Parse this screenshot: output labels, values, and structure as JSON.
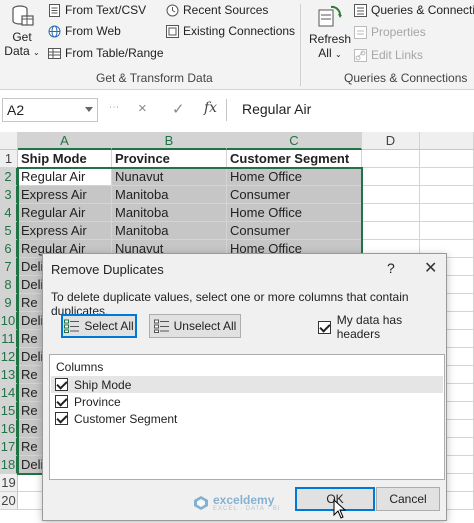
{
  "ribbon": {
    "get_data": {
      "line1": "Get",
      "line2": "Data"
    },
    "from_text_csv": "From Text/CSV",
    "from_web": "From Web",
    "from_table_range": "From Table/Range",
    "recent_sources": "Recent Sources",
    "existing_connections": "Existing Connections",
    "group_get_transform": "Get & Transform Data",
    "refresh": {
      "line1": "Refresh",
      "line2": "All"
    },
    "queries_connections": "Queries & Connections",
    "properties": "Properties",
    "edit_links": "Edit Links",
    "group_queries": "Queries & Connections"
  },
  "formula_bar": {
    "name_box": "A2",
    "cancel_icon": "×",
    "enter_icon": "✓",
    "fx_label": "fx",
    "content": "Regular Air"
  },
  "grid": {
    "columns": [
      "A",
      "B",
      "C",
      "D"
    ],
    "row_numbers": [
      "1",
      "2",
      "3",
      "4",
      "5",
      "6",
      "7",
      "8",
      "9",
      "10",
      "11",
      "12",
      "13",
      "14",
      "15",
      "16",
      "17",
      "18",
      "19",
      "20"
    ],
    "header_row": [
      "Ship Mode",
      "Province",
      "Customer Segment"
    ],
    "rows": [
      [
        "Regular Air",
        "Nunavut",
        "Home Office"
      ],
      [
        "Express Air",
        "Manitoba",
        "Consumer"
      ],
      [
        "Regular Air",
        "Manitoba",
        "Home Office"
      ],
      [
        "Express Air",
        "Manitoba",
        "Consumer"
      ],
      [
        "Regular Air",
        "Nunavut",
        "Home Office"
      ]
    ],
    "hidden_rows_prefix": [
      "Deli",
      "Deli",
      "Re",
      "Deli",
      "Re",
      "Deli",
      "Re",
      "Re",
      "Re",
      "Re",
      "Re",
      "Deli"
    ]
  },
  "dialog": {
    "title": "Remove Duplicates",
    "help": "?",
    "close": "✕",
    "instructions": "To delete duplicate values, select one or more columns that contain duplicates.",
    "select_all": "Select All",
    "unselect_all": "Unselect All",
    "my_data_has_headers": "My data has headers",
    "columns_header": "Columns",
    "columns": [
      "Ship Mode",
      "Province",
      "Customer Segment"
    ],
    "ok": "OK",
    "cancel": "Cancel"
  },
  "watermark": {
    "name": "exceldemy",
    "sub": "EXCEL · DATA · BI"
  },
  "colors": {
    "excel_green": "#217346",
    "selection_gray": "#c6c6c6",
    "focus_blue": "#0078d7"
  }
}
